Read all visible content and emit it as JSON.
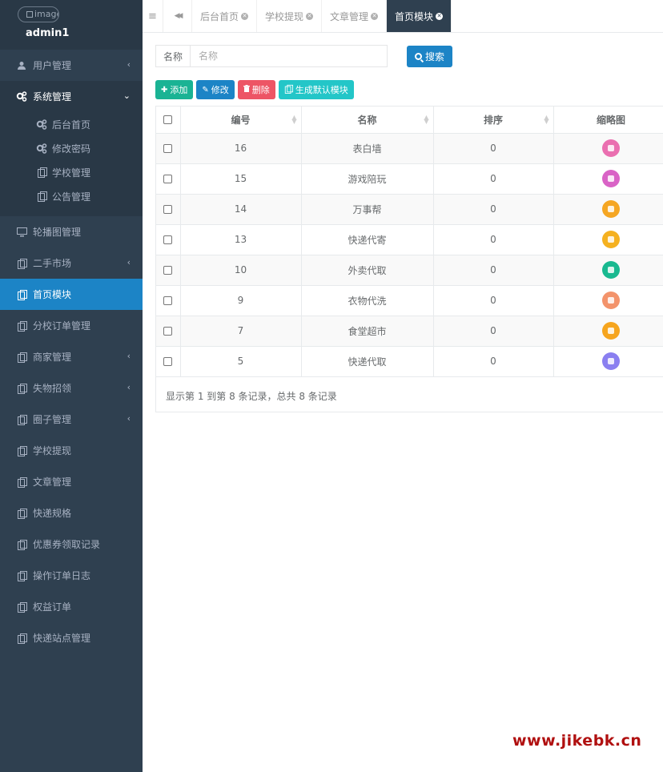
{
  "profile": {
    "image_alt": "image",
    "name": "admin1"
  },
  "sidebar": {
    "items": [
      {
        "label": "用户管理",
        "icon": "user-icon",
        "caret": "‹"
      },
      {
        "label": "系统管理",
        "icon": "gears-icon",
        "caret": "⌄"
      },
      {
        "label": "轮播图管理",
        "icon": "monitor-icon"
      },
      {
        "label": "二手市场",
        "icon": "copy-icon",
        "caret": "‹"
      },
      {
        "label": "首页模块",
        "icon": "copy-icon"
      },
      {
        "label": "分校订单管理",
        "icon": "copy-icon"
      },
      {
        "label": "商家管理",
        "icon": "copy-icon",
        "caret": "‹"
      },
      {
        "label": "失物招领",
        "icon": "copy-icon",
        "caret": "‹"
      },
      {
        "label": "圈子管理",
        "icon": "copy-icon",
        "caret": "‹"
      },
      {
        "label": "学校提现",
        "icon": "copy-icon"
      },
      {
        "label": "文章管理",
        "icon": "copy-icon"
      },
      {
        "label": "快递规格",
        "icon": "copy-icon"
      },
      {
        "label": "优惠券领取记录",
        "icon": "copy-icon"
      },
      {
        "label": "操作订单日志",
        "icon": "copy-icon"
      },
      {
        "label": "权益订单",
        "icon": "copy-icon"
      },
      {
        "label": "快递站点管理",
        "icon": "copy-icon"
      }
    ],
    "system_submenu": [
      {
        "label": "后台首页",
        "icon": "gears-icon"
      },
      {
        "label": "修改密码",
        "icon": "gears-icon"
      },
      {
        "label": "学校管理",
        "icon": "copy-icon"
      },
      {
        "label": "公告管理",
        "icon": "copy-icon"
      }
    ]
  },
  "topbar": {
    "menu_toggle": "≡",
    "back": "◀◀",
    "tabs": [
      {
        "label": "后台首页"
      },
      {
        "label": "学校提现"
      },
      {
        "label": "文章管理"
      },
      {
        "label": "首页模块"
      }
    ],
    "close_glyph": "✕"
  },
  "search": {
    "label": "名称",
    "placeholder": "名称",
    "button": "搜索"
  },
  "toolbar": {
    "add": "添加",
    "edit": "修改",
    "delete": "删除",
    "generate": "生成默认模块"
  },
  "table": {
    "headers": {
      "id": "编号",
      "name": "名称",
      "sort": "排序",
      "thumb": "缩略图"
    },
    "rows": [
      {
        "id": "16",
        "name": "表白墙",
        "sort": "0",
        "thumb_color": "#ea6fb0"
      },
      {
        "id": "15",
        "name": "游戏陪玩",
        "sort": "0",
        "thumb_color": "#d963c6"
      },
      {
        "id": "14",
        "name": "万事帮",
        "sort": "0",
        "thumb_color": "#f5a623"
      },
      {
        "id": "13",
        "name": "快递代寄",
        "sort": "0",
        "thumb_color": "#f5b120"
      },
      {
        "id": "10",
        "name": "外卖代取",
        "sort": "0",
        "thumb_color": "#19b990"
      },
      {
        "id": "9",
        "name": "衣物代洗",
        "sort": "0",
        "thumb_color": "#f3936b"
      },
      {
        "id": "7",
        "name": "食堂超市",
        "sort": "0",
        "thumb_color": "#f6a51e"
      },
      {
        "id": "5",
        "name": "快递代取",
        "sort": "0",
        "thumb_color": "#8a7ff0"
      }
    ]
  },
  "pager": {
    "summary": "显示第 1 到第 8 条记录，总共 8 条记录"
  },
  "watermark": {
    "text": "www.jikebk.cn"
  },
  "colors": {
    "sidebar_bg": "#2f4050",
    "active": "#1c84c6",
    "add": "#1ab394",
    "delete": "#ed5565",
    "generate": "#23c6c8"
  }
}
